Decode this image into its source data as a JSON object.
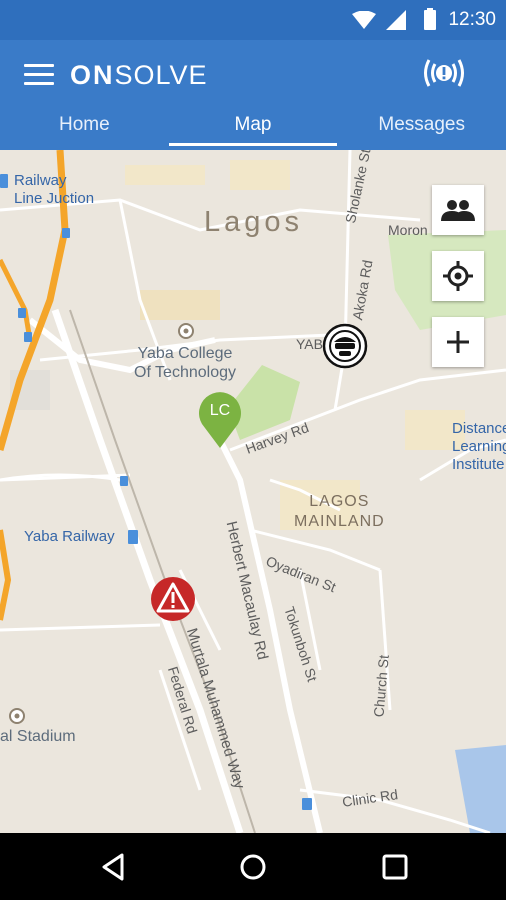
{
  "status_bar": {
    "time": "12:30",
    "icons": [
      "wifi-icon",
      "signal-icon",
      "battery-icon"
    ]
  },
  "app_bar": {
    "logo_bold": "ON",
    "logo_light": "SOLVE",
    "icons": [
      "menu-icon",
      "alert-broadcast-icon"
    ]
  },
  "tabs": [
    {
      "label": "Home",
      "active": false
    },
    {
      "label": "Map",
      "active": true
    },
    {
      "label": "Messages",
      "active": false
    }
  ],
  "map": {
    "labels": {
      "railway_junction": "Railway\nLine Juction",
      "lagos": "Lagos",
      "moron": "Moron",
      "yaba_short": "YAB",
      "yaba_college": "Yaba College\nOf Technology",
      "harvey_rd": "Harvey Rd",
      "distance_learning": "Distance\nLearning\nInstitute",
      "lagos_mainland": "LAGOS\nMAINLAND",
      "yaba_railway": "Yaba Railway",
      "oyadiran_st": "Oyadiran St",
      "tokunboh_st": "Tokunboh St",
      "herbert_macaulay_rd": "Herbert Macaulay Rd",
      "murtala_muhammed_way": "Murtala Muhammed Way",
      "federal_rd": "Federal Rd",
      "church_st": "Church St",
      "stadium": "al Stadium",
      "clinic_rd": "Clinic Rd",
      "sholanke_st": "Sholanke St",
      "akoka_rd": "Akoka Rd"
    },
    "markers": {
      "lc_label": "LC",
      "lc_color": "#7cb342",
      "alert_color": "#c62828"
    },
    "controls": [
      "people-icon",
      "locate-icon",
      "add-icon"
    ]
  },
  "colors": {
    "app_bar": "#3a7bc8",
    "status_bar": "#2f6fbd",
    "map_bg": "#ebe6dd",
    "highway": "#f4a52a",
    "park": "#c9e2a8"
  },
  "nav_bar": {
    "icons": [
      "back-icon",
      "home-icon",
      "recents-icon"
    ]
  }
}
